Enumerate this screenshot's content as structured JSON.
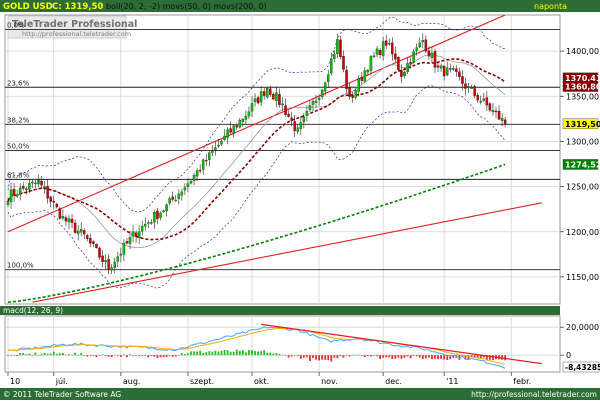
{
  "header": {
    "symbol": "GOLD USD",
    "price_label": "C: 1319,50",
    "indicators": "boll(20, 2, -2) movs(50, 0) movs(200, 0)",
    "period": "naponta"
  },
  "watermark": {
    "brand": "TeleTrader Professional",
    "url": "http://professional.teletrader.com"
  },
  "footer": {
    "copyright": "© 2011 TeleTrader Software AG",
    "url": "http://professional.teletrader.com"
  },
  "macd_label": "macd(12, 26, 9)",
  "colors": {
    "background": "#ffffff",
    "header_bg": "#2b6d35",
    "header_text": "#ffff00",
    "grid": "#d4d4d4",
    "candle_up": "#00c000",
    "candle_down": "#d00000",
    "boll": "#2a2ab8",
    "ma50": "#8b0000",
    "ma200": "#008000",
    "trend": "#e02020",
    "fib": "#202020",
    "macd": "#40a8ff",
    "macd_signal": "#ffaa00",
    "hist_up": "#20c020",
    "hist_down": "#e03030"
  },
  "chart_data": [
    {
      "type": "candlestick",
      "title": "GOLD USD C: 1319,50",
      "ylim": [
        1120,
        1440
      ],
      "yticks": [
        1150,
        1200,
        1250,
        1300,
        1350,
        1400
      ],
      "ytick_labels": [
        "1150,00",
        "1200,00",
        "1250,00",
        "1300,00",
        "1350,00",
        "1400,00"
      ],
      "xtick_labels": [
        "10",
        "júl.",
        "aug.",
        "szept.",
        "okt.",
        "nov.",
        "dec.",
        "'11",
        "febr."
      ],
      "xtick_index": [
        0,
        15,
        37,
        59,
        80,
        102,
        123,
        143,
        165
      ],
      "fib_levels": [
        {
          "label": "0,0%",
          "value": 1424
        },
        {
          "label": "23,6%",
          "value": 1360
        },
        {
          "label": "38,2%",
          "value": 1319
        },
        {
          "label": "50,0%",
          "value": 1290
        },
        {
          "label": "61,8%",
          "value": 1258
        },
        {
          "label": "100,0%",
          "value": 1158
        }
      ],
      "price_tags": [
        {
          "label": "1370,41",
          "value": 1370.41,
          "color": "#8b0000"
        },
        {
          "label": "1360,80",
          "value": 1360.8,
          "color": "#8b0000"
        },
        {
          "label": "1319,50",
          "value": 1319.5,
          "color": "#ffff00"
        },
        {
          "label": "1274,52",
          "value": 1274.52,
          "color": "#008000"
        }
      ],
      "trendlines": [
        {
          "from": [
            0,
            1200
          ],
          "to": [
            163,
            1440
          ]
        },
        {
          "from": [
            8,
            1122
          ],
          "to": [
            175,
            1232
          ]
        }
      ],
      "key_prices": [
        {
          "i": 0,
          "p": 1240
        },
        {
          "i": 10,
          "p": 1255
        },
        {
          "i": 18,
          "p": 1215
        },
        {
          "i": 25,
          "p": 1195
        },
        {
          "i": 33,
          "p": 1160
        },
        {
          "i": 42,
          "p": 1200
        },
        {
          "i": 52,
          "p": 1228
        },
        {
          "i": 60,
          "p": 1258
        },
        {
          "i": 70,
          "p": 1300
        },
        {
          "i": 78,
          "p": 1330
        },
        {
          "i": 85,
          "p": 1360
        },
        {
          "i": 90,
          "p": 1340
        },
        {
          "i": 95,
          "p": 1310
        },
        {
          "i": 103,
          "p": 1360
        },
        {
          "i": 108,
          "p": 1410
        },
        {
          "i": 112,
          "p": 1345
        },
        {
          "i": 118,
          "p": 1385
        },
        {
          "i": 124,
          "p": 1410
        },
        {
          "i": 129,
          "p": 1375
        },
        {
          "i": 136,
          "p": 1412
        },
        {
          "i": 141,
          "p": 1380
        },
        {
          "i": 146,
          "p": 1375
        },
        {
          "i": 152,
          "p": 1355
        },
        {
          "i": 160,
          "p": 1330
        },
        {
          "i": 163,
          "p": 1319.5
        }
      ]
    },
    {
      "type": "macd",
      "title": "macd(12, 26, 9)",
      "ylim": [
        -12,
        28
      ],
      "yticks": [
        20,
        0
      ],
      "ytick_labels": [
        "20,0000",
        "0"
      ],
      "last_value_label": "-8,43285",
      "last_value": -8.43285,
      "macd_points": [
        {
          "i": 0,
          "v": 3
        },
        {
          "i": 20,
          "v": 8
        },
        {
          "i": 40,
          "v": 6
        },
        {
          "i": 55,
          "v": 4
        },
        {
          "i": 70,
          "v": 12
        },
        {
          "i": 85,
          "v": 20
        },
        {
          "i": 95,
          "v": 18
        },
        {
          "i": 105,
          "v": 10
        },
        {
          "i": 115,
          "v": 12
        },
        {
          "i": 125,
          "v": 8
        },
        {
          "i": 135,
          "v": 5
        },
        {
          "i": 145,
          "v": 0
        },
        {
          "i": 155,
          "v": -4
        },
        {
          "i": 163,
          "v": -8.43
        }
      ],
      "trendline": {
        "from": [
          83,
          22
        ],
        "to": [
          175,
          -6
        ]
      }
    }
  ]
}
